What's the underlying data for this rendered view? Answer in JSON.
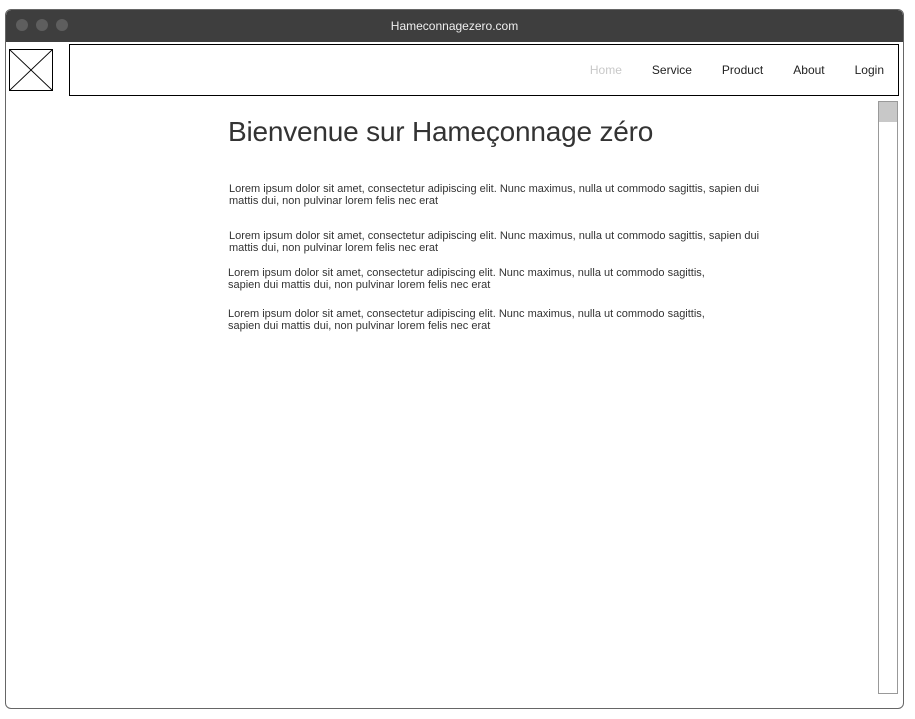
{
  "window": {
    "title": "Hameconnagezero.com"
  },
  "nav": {
    "items": [
      {
        "label": "Home"
      },
      {
        "label": "Service"
      },
      {
        "label": "Product"
      },
      {
        "label": "About"
      },
      {
        "label": "Login"
      }
    ]
  },
  "main": {
    "title": "Bienvenue sur Hameçonnage zéro",
    "paragraphs": [
      {
        "line1": "Lorem ipsum dolor sit amet, consectetur adipiscing elit. Nunc maximus, nulla ut commodo sagittis, sapien dui",
        "line2": "mattis dui, non pulvinar lorem felis nec erat"
      },
      {
        "line1": "Lorem ipsum dolor sit amet, consectetur adipiscing elit. Nunc maximus, nulla ut commodo sagittis, sapien dui",
        "line2": "mattis dui, non pulvinar lorem felis nec erat"
      },
      {
        "line1": "Lorem ipsum dolor sit amet, consectetur adipiscing elit. Nunc maximus, nulla ut commodo sagittis,",
        "line2": "sapien dui mattis dui, non pulvinar lorem felis nec erat"
      },
      {
        "line1": "Lorem ipsum dolor sit amet, consectetur adipiscing elit. Nunc maximus, nulla ut commodo sagittis,",
        "line2": "sapien dui mattis dui, non pulvinar lorem felis nec erat"
      }
    ]
  },
  "icons": {
    "logo": "image-placeholder-icon"
  },
  "colors": {
    "titlebar": "#3e3e3e",
    "nav_disabled": "#c8c8c8",
    "text": "#333333"
  }
}
